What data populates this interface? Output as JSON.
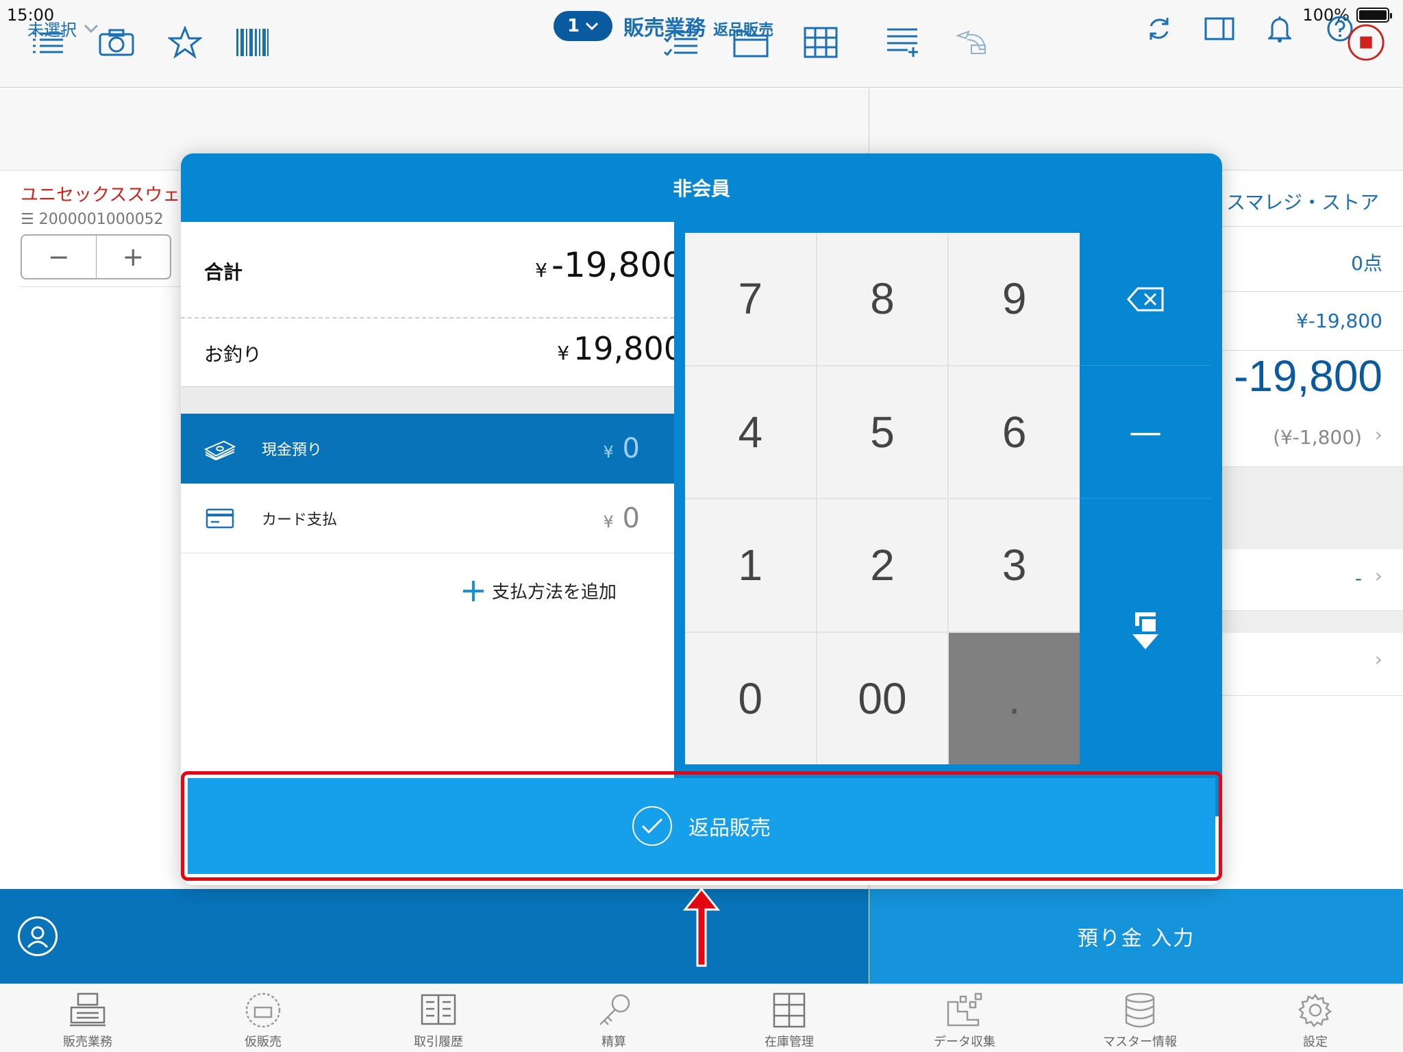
{
  "status": {
    "time": "15:00",
    "battery": "100%"
  },
  "nav": {
    "left_select": "未選択",
    "register_no": "1",
    "title": "販売業務",
    "subtitle": "返品販売"
  },
  "left_panel": {
    "item_name": "ユニセックススウェ",
    "item_code": "2000001000052",
    "stepper_minus": "−",
    "stepper_plus": "+"
  },
  "right_panel": {
    "store": "スマレジ・ストア",
    "count": "0点",
    "subtotal": "¥-19,800",
    "total": "-19,800",
    "tax": "(¥-1,800)",
    "customer": "-"
  },
  "modal": {
    "header": "非会員",
    "total_label": "合計",
    "total_yen": "¥",
    "total_value": "-19,800",
    "change_label": "お釣り",
    "change_yen": "¥",
    "change_value": "19,800",
    "payments": [
      {
        "label": "現金預り",
        "yen": "¥",
        "amount": "0"
      },
      {
        "label": "カード支払",
        "yen": "¥",
        "amount": "0"
      }
    ],
    "add_payment": "支払方法を追加",
    "keys": [
      "7",
      "8",
      "9",
      "4",
      "5",
      "6",
      "1",
      "2",
      "3",
      "0",
      "00",
      "."
    ],
    "minus_key": "—",
    "confirm_label": "返品販売"
  },
  "bottom": {
    "deposit_button": "預り金 入力"
  },
  "tabs": [
    {
      "label": "販売業務",
      "icon": "register-icon"
    },
    {
      "label": "仮販売",
      "icon": "temp-register-icon"
    },
    {
      "label": "取引履歴",
      "icon": "ledger-icon"
    },
    {
      "label": "精算",
      "icon": "key-icon"
    },
    {
      "label": "在庫管理",
      "icon": "cabinet-icon"
    },
    {
      "label": "データ収集",
      "icon": "data-icon"
    },
    {
      "label": "マスター情報",
      "icon": "database-icon"
    },
    {
      "label": "設定",
      "icon": "gear-icon"
    }
  ],
  "colors": {
    "accent": "#0786d2",
    "confirm": "#16a0ec",
    "highlight": "#e30613",
    "text_blue": "#1b6fb5"
  }
}
